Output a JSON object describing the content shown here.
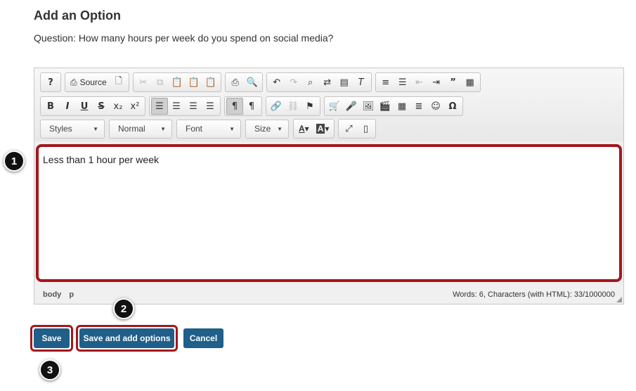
{
  "header": {
    "title": "Add an Option",
    "question": "Question: How many hours per week do you spend on social media?"
  },
  "toolbar": {
    "source_label": "Source",
    "styles_label": "Styles",
    "format_label": "Normal",
    "font_label": "Font",
    "size_label": "Size"
  },
  "editor": {
    "content": "Less than 1 hour per week",
    "path": [
      "body",
      "p"
    ],
    "word_count": "Words: 6, Characters (with HTML): 33/1000000"
  },
  "buttons": {
    "save": "Save",
    "save_add": "Save and add options",
    "cancel": "Cancel"
  },
  "callouts": [
    "1",
    "2",
    "3"
  ],
  "colors": {
    "highlight": "#a4161a",
    "button": "#1f5f89"
  }
}
